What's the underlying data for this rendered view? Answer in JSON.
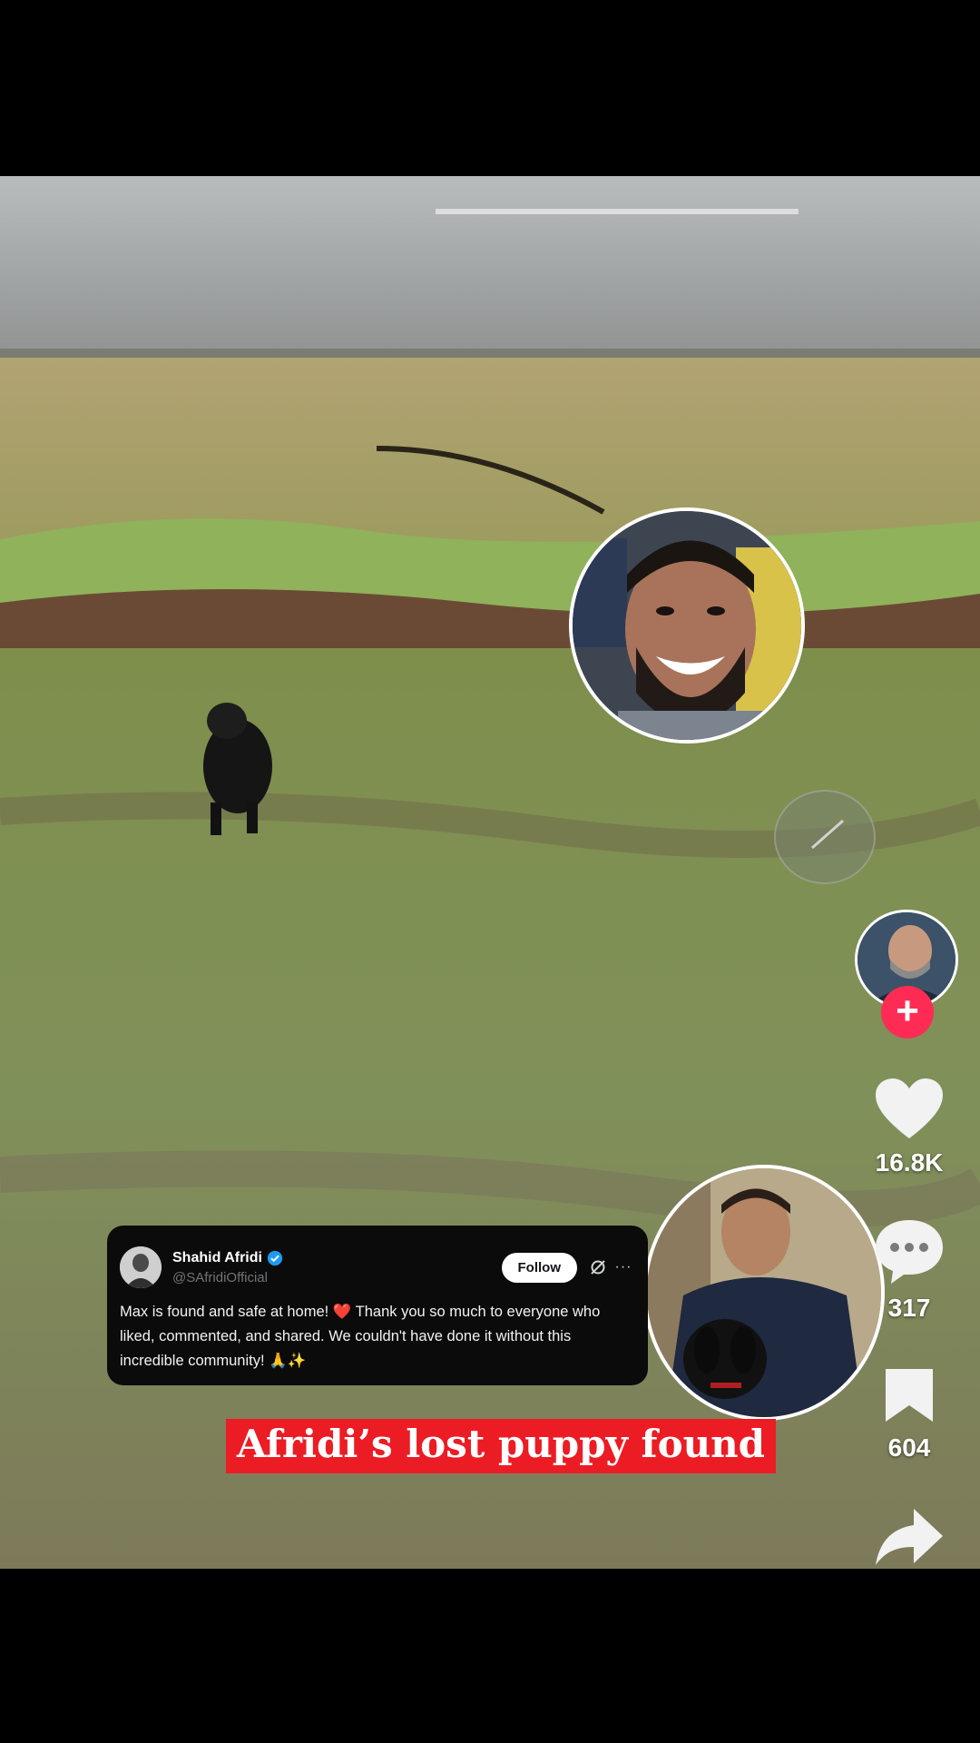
{
  "video": {
    "caption": "Afridi’s lost puppy found"
  },
  "tweet": {
    "name": "Shahid Afridi",
    "handle": "@SAfridiOfficial",
    "follow_label": "Follow",
    "text": "Max is found and safe at home! ❤️ Thank you so much to everyone who liked, commented, and shared. We couldn't have done it without this incredible community! 🙏✨",
    "more_glyph": "···"
  },
  "actions": {
    "likes": "16.8K",
    "comments": "317",
    "saves": "604",
    "follow_plus": "+"
  },
  "colors": {
    "accent_red": "#fe2c55",
    "caption_red": "#ec1c24",
    "tweet_bg": "#0b0b0b",
    "verified_blue": "#1d9bf0"
  },
  "icons": [
    "heart-icon",
    "comment-icon",
    "bookmark-icon",
    "share-icon",
    "verified-icon",
    "grok-icon",
    "more-icon",
    "plus-icon",
    "music-disc-icon"
  ]
}
